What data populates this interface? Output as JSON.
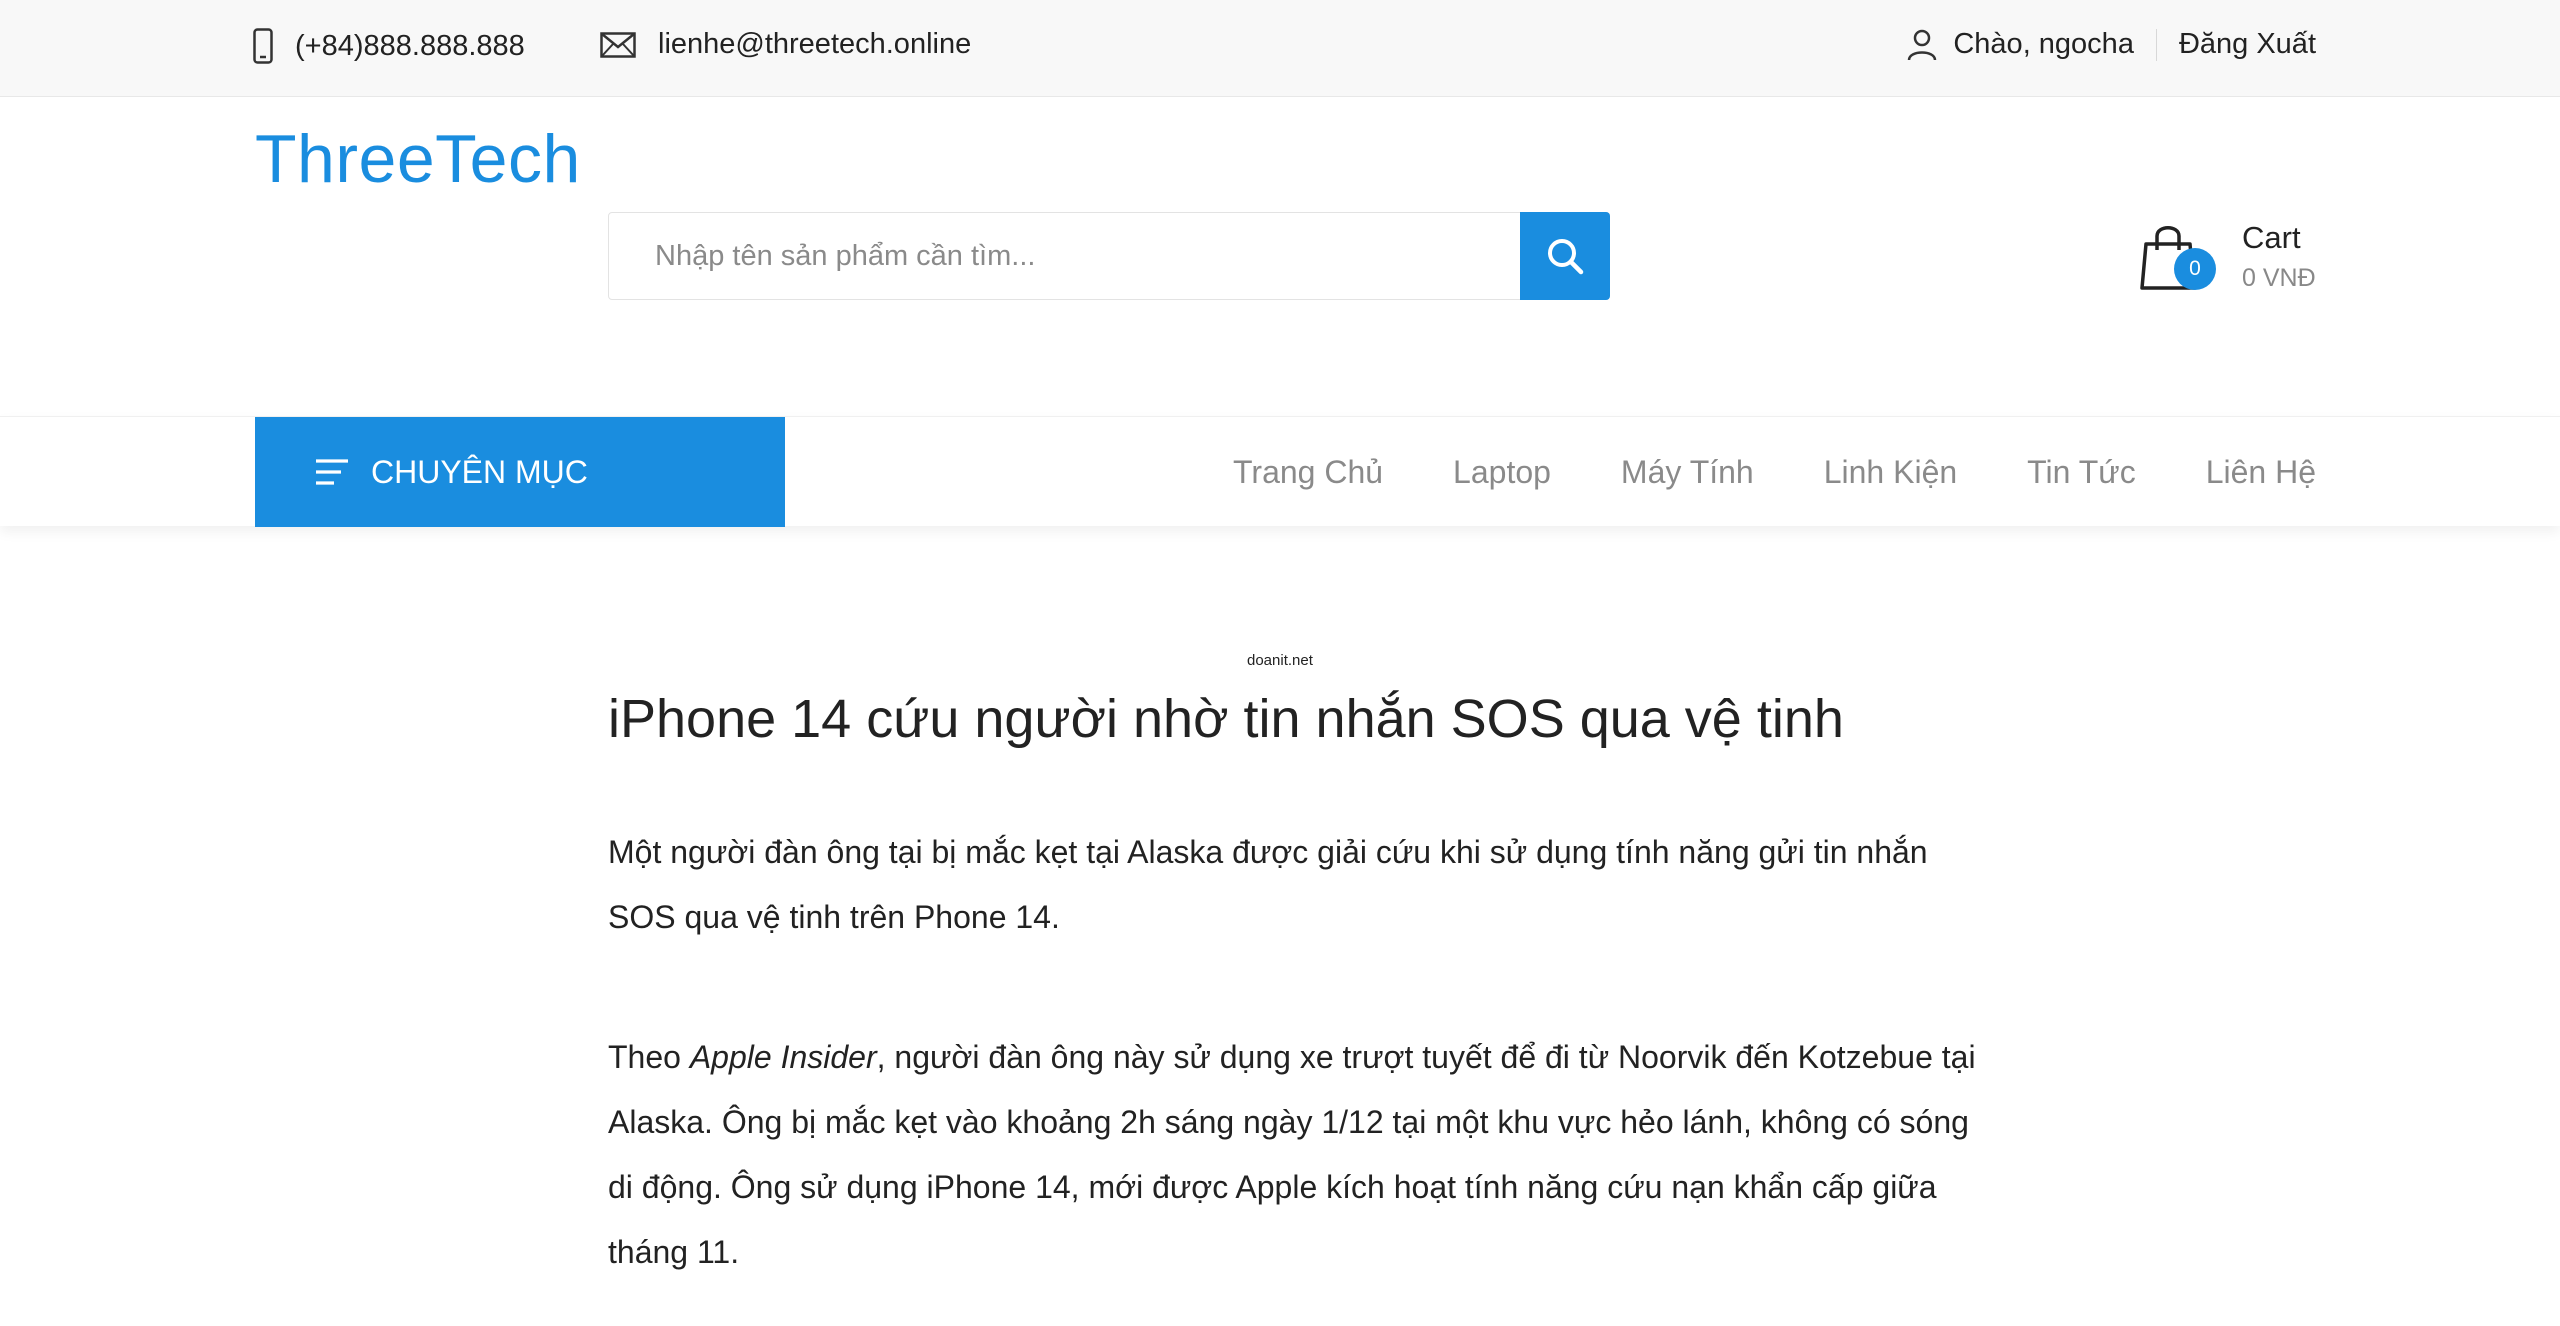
{
  "topbar": {
    "phone": "(+84)888.888.888",
    "email": "lienhe@threetech.online",
    "greeting": "Chào, ngocha",
    "logout": "Đăng Xuất"
  },
  "header": {
    "logo": "ThreeTech",
    "search_placeholder": "Nhập tên sản phẩm cần tìm...",
    "cart_label": "Cart",
    "cart_count": "0",
    "cart_total": "0 VNĐ"
  },
  "nav": {
    "category_label": "CHUYÊN MỤC",
    "items": [
      "Trang Chủ",
      "Laptop",
      "Máy Tính",
      "Linh Kiện",
      "Tin Tức",
      "Liên Hệ"
    ]
  },
  "article": {
    "note": "doanit.net",
    "title": "iPhone 14 cứu người nhờ tin nhắn SOS qua vệ tinh",
    "intro": "Một người đàn ông tại bị mắc kẹt tại Alaska được giải cứu khi sử dụng tính năng gửi tin nhắn SOS qua vệ tinh trên Phone 14.",
    "p2_lead": "Theo ",
    "p2_source": "Apple Insider",
    "p2_rest": ", người đàn ông này sử dụng xe trượt tuyết để đi từ Noorvik đến Kotzebue tại Alaska. Ông bị mắc kẹt vào khoảng 2h sáng ngày 1/12 tại một khu vực hẻo lánh, không có sóng di động. Ông sử dụng iPhone 14, mới được Apple kích hoạt tính năng cứu nạn khẩn cấp giữa tháng 11."
  },
  "colors": {
    "accent": "#1a8ddf",
    "topbar_bg": "#f8f8f8",
    "muted_text": "#8a8a8a"
  },
  "icons": {
    "phone": "mobile-phone-icon",
    "email": "envelope-icon",
    "user": "user-icon",
    "search": "search-icon",
    "cart": "shopping-bag-icon",
    "menu": "filter-lines-icon"
  }
}
